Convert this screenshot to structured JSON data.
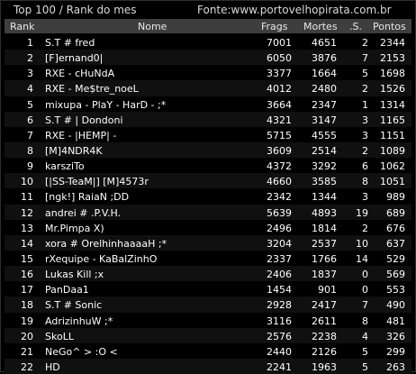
{
  "title": {
    "left": "Top 100 / Rank do mes",
    "right": "Fonte:www.portovelhopirata.com.br"
  },
  "columns": {
    "rank": "Rank",
    "name": "Nome",
    "frags": "Frags",
    "mortes": "Mortes",
    "s": ".S.",
    "pontos": "Pontos"
  },
  "rows": [
    {
      "rank": "1",
      "name": "S.T # fred",
      "frags": "7001",
      "mortes": "4651",
      "s": "2",
      "pontos": "2344"
    },
    {
      "rank": "2",
      "name": "[F]ernand0|",
      "frags": "6050",
      "mortes": "3876",
      "s": "7",
      "pontos": "2153"
    },
    {
      "rank": "3",
      "name": "RXE - cHuNdA",
      "frags": "3377",
      "mortes": "1664",
      "s": "5",
      "pontos": "1698"
    },
    {
      "rank": "4",
      "name": "RXE - Me$tre_noeL",
      "frags": "4012",
      "mortes": "2480",
      "s": "2",
      "pontos": "1526"
    },
    {
      "rank": "5",
      "name": "mixupa - PlaY - HarD - ;*",
      "frags": "3664",
      "mortes": "2347",
      "s": "1",
      "pontos": "1314"
    },
    {
      "rank": "6",
      "name": "S.T # | Dondoni",
      "frags": "4321",
      "mortes": "3147",
      "s": "3",
      "pontos": "1165"
    },
    {
      "rank": "7",
      "name": "RXE - |HEMP| -",
      "frags": "5715",
      "mortes": "4555",
      "s": "3",
      "pontos": "1151"
    },
    {
      "rank": "8",
      "name": "[M]4NDR4K",
      "frags": "3609",
      "mortes": "2514",
      "s": "2",
      "pontos": "1089"
    },
    {
      "rank": "9",
      "name": "karsziTo",
      "frags": "4372",
      "mortes": "3292",
      "s": "6",
      "pontos": "1062"
    },
    {
      "rank": "10",
      "name": "[|SS-TeaM|] [M]4573r",
      "frags": "4660",
      "mortes": "3585",
      "s": "8",
      "pontos": "1051"
    },
    {
      "rank": "11",
      "name": "[ngk!] RaiaN ;DD",
      "frags": "2342",
      "mortes": "1344",
      "s": "3",
      "pontos": "989"
    },
    {
      "rank": "12",
      "name": "andrei # .P.V.H.",
      "frags": "5639",
      "mortes": "4893",
      "s": "19",
      "pontos": "689"
    },
    {
      "rank": "13",
      "name": "Mr.Pimpa X)",
      "frags": "2496",
      "mortes": "1814",
      "s": "2",
      "pontos": "676"
    },
    {
      "rank": "14",
      "name": "xora # OrelhinhaaaaH ;*",
      "frags": "3204",
      "mortes": "2537",
      "s": "10",
      "pontos": "637"
    },
    {
      "rank": "15",
      "name": "rXequipe - KaBalZinhO",
      "frags": "2337",
      "mortes": "1766",
      "s": "14",
      "pontos": "529"
    },
    {
      "rank": "16",
      "name": "Lukas Kill ;x",
      "frags": "2406",
      "mortes": "1837",
      "s": "0",
      "pontos": "569"
    },
    {
      "rank": "17",
      "name": "PanDaa1",
      "frags": "1454",
      "mortes": "901",
      "s": "0",
      "pontos": "553"
    },
    {
      "rank": "18",
      "name": "S.T # Sonic",
      "frags": "2928",
      "mortes": "2417",
      "s": "7",
      "pontos": "490"
    },
    {
      "rank": "19",
      "name": "AdrizinhuW ;*",
      "frags": "3116",
      "mortes": "2611",
      "s": "8",
      "pontos": "481"
    },
    {
      "rank": "20",
      "name": "SkoLL",
      "frags": "2576",
      "mortes": "2238",
      "s": "4",
      "pontos": "326"
    },
    {
      "rank": "21",
      "name": "NeGo^ > :O <",
      "frags": "2440",
      "mortes": "2126",
      "s": "5",
      "pontos": "299"
    },
    {
      "rank": "22",
      "name": "HD",
      "frags": "2241",
      "mortes": "1963",
      "s": "5",
      "pontos": "263"
    }
  ]
}
